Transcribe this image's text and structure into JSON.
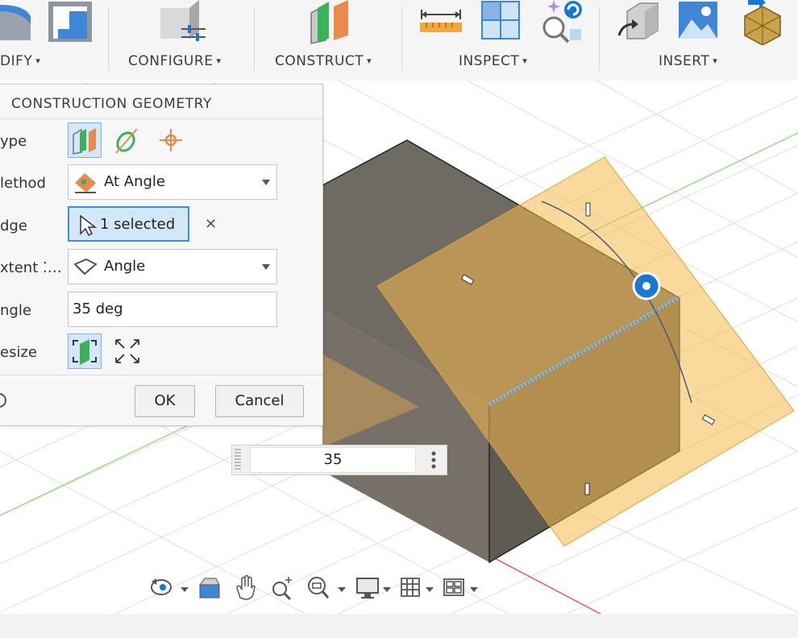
{
  "toolbar": {
    "groups": [
      {
        "label": "DIFY"
      },
      {
        "label": "CONFIGURE"
      },
      {
        "label": "CONSTRUCT"
      },
      {
        "label": "INSPECT"
      },
      {
        "label": "INSERT"
      }
    ],
    "caret": "▾"
  },
  "dialog": {
    "title": "CONSTRUCTION GEOMETRY",
    "rows": {
      "type": "ype",
      "method": "lethod",
      "edge": "dge",
      "extent": "xtent ⁚…",
      "angle": "ngle",
      "resize": "esize"
    },
    "method_value": "At Angle",
    "edge_value": "1 selected",
    "extent_value": "Angle",
    "angle_value": "35 deg",
    "ok_label": "OK",
    "cancel_label": "Cancel",
    "clear_glyph": "✕"
  },
  "value_input": {
    "value": "35"
  },
  "colors": {
    "plane_orange": "#f5b94a",
    "body_gray": "#6e6b63",
    "accent_blue": "#1b78d0",
    "toolbar_bg": "#f5f5f5"
  }
}
